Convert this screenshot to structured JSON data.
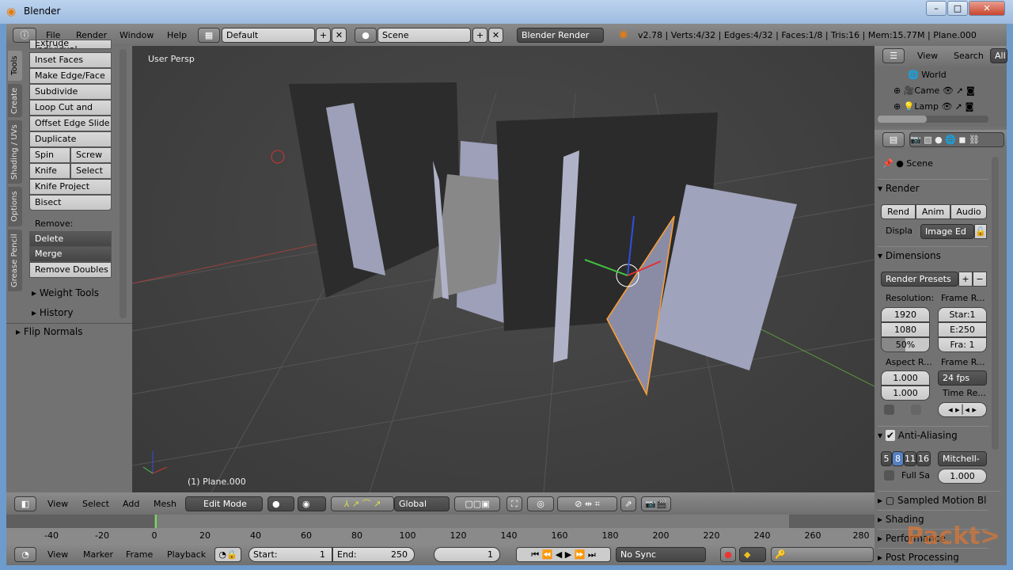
{
  "window": {
    "title": "Blender",
    "controls": [
      "–",
      "□",
      "✕"
    ]
  },
  "info_header": {
    "menus": [
      "File",
      "Render",
      "Window",
      "Help"
    ],
    "layout": "Default",
    "scene": "Scene",
    "engine": "Blender Render",
    "stats": "v2.78 | Verts:4/32 | Edges:4/32 | Faces:1/8 | Tris:16 | Mem:15.77M | Plane.000"
  },
  "tool_shelf": {
    "tabs": [
      "Tools",
      "Create",
      "Shading / UVs",
      "Options",
      "Grease Pencil"
    ],
    "buttons": [
      "Extrude Individual",
      "Inset Faces",
      "Make Edge/Face",
      "Subdivide",
      "Loop Cut and Slide",
      "Offset Edge Slide",
      "Duplicate"
    ],
    "pairs": [
      [
        "Spin",
        "Screw"
      ],
      [
        "Knife",
        "Select"
      ]
    ],
    "buttons2": [
      "Knife Project",
      "Bisect"
    ],
    "remove_label": "Remove:",
    "delete": "Delete",
    "merge": "Merge",
    "remove_doubles": "Remove Doubles",
    "weight_tools": "Weight Tools",
    "history": "History",
    "operator_panel": "Flip Normals"
  },
  "viewport": {
    "view_label": "User Persp",
    "object_label": "(1) Plane.000"
  },
  "view3d_header": {
    "menus": [
      "View",
      "Select",
      "Add",
      "Mesh"
    ],
    "mode": "Edit Mode",
    "orientation": "Global"
  },
  "timeline": {
    "ticks": [
      "-40",
      "-20",
      "0",
      "20",
      "40",
      "60",
      "80",
      "100",
      "120",
      "140",
      "160",
      "180",
      "200",
      "220",
      "240",
      "260",
      "280"
    ],
    "current_frame": 1,
    "menus": [
      "View",
      "Marker",
      "Frame",
      "Playback"
    ],
    "start_label": "Start:",
    "start": "1",
    "end_label": "End:",
    "end": "250",
    "frame": "1",
    "sync": "No Sync"
  },
  "outliner": {
    "menus": [
      "View",
      "Search",
      "All"
    ],
    "items": [
      "World",
      "Came",
      "Lamp"
    ]
  },
  "properties": {
    "context": "Scene",
    "render": {
      "title": "Render",
      "buttons": [
        "Rend",
        "Anim",
        "Audio"
      ],
      "display_label": "Displa",
      "display": "Image Ed"
    },
    "dimensions": {
      "title": "Dimensions",
      "presets": "Render Presets",
      "resolution_label": "Resolution:",
      "res_x": "1920",
      "res_y": "1080",
      "res_pct": "50%",
      "frame_range_label": "Frame R...",
      "start": "Star:1",
      "end": "E:250",
      "frame": "Fra: 1",
      "aspect_label": "Aspect R...",
      "aspect_x": "1.000",
      "aspect_y": "1.000",
      "frame_rate_label": "Frame R...",
      "fps": "24 fps",
      "time_remap_label": "Time Re..."
    },
    "anti_aliasing": {
      "title": "Anti-Aliasing",
      "enabled": true,
      "samples": [
        "5",
        "8",
        "11",
        "16"
      ],
      "selected": "8",
      "filter": "Mitchell-",
      "full_sample": "Full Sa",
      "size": "1.000"
    },
    "collapsed": [
      "Sampled Motion Bl",
      "Shading",
      "Performance",
      "Post Processing"
    ]
  },
  "watermark": "Packt>",
  "colors": {
    "accent_blue": "#5680c2",
    "selection": "#ffa030",
    "x_axis": "#c84040",
    "y_axis": "#70c040"
  }
}
